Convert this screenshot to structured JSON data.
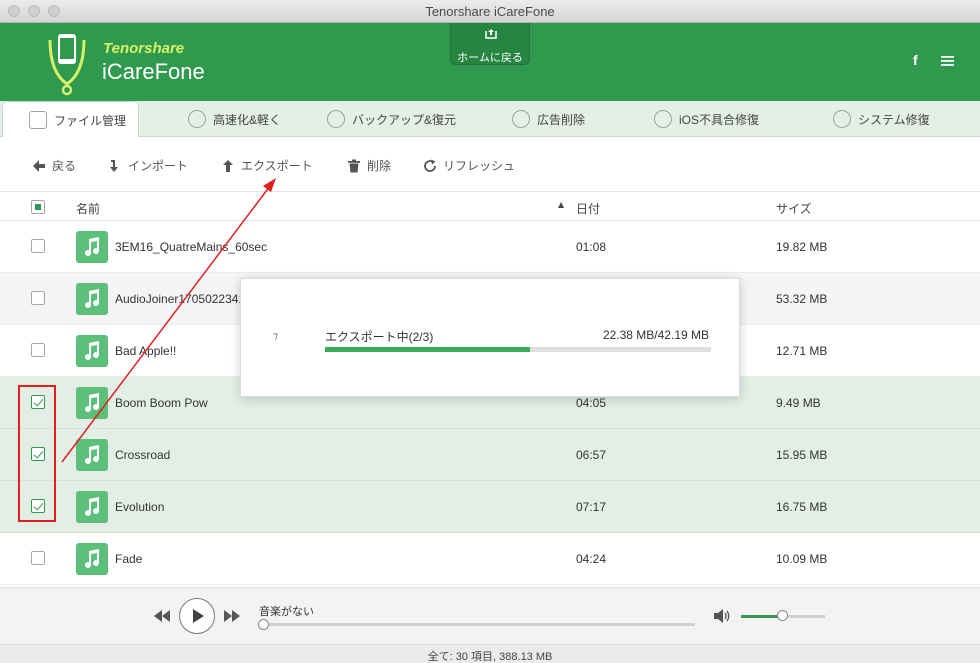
{
  "window": {
    "title": "Tenorshare iCareFone"
  },
  "header": {
    "brand_small": "Tenorshare",
    "brand_big": "iCareFone",
    "home_label": "ホームに戻る",
    "facebook_label": "f"
  },
  "tabs": [
    {
      "label": "ファイル管理",
      "icon": "file-manage-icon",
      "active": true
    },
    {
      "label": "高速化&軽く",
      "icon": "rocket-icon",
      "active": false
    },
    {
      "label": "バックアップ&復元",
      "icon": "folder-icon",
      "active": false
    },
    {
      "label": "広告削除",
      "icon": "trash-icon",
      "active": false
    },
    {
      "label": "iOS不具合修復",
      "icon": "refresh-icon",
      "active": false
    },
    {
      "label": "システム修復",
      "icon": "wrench-icon",
      "active": false
    }
  ],
  "toolbar": {
    "back": "戻る",
    "import": "インポート",
    "export": "エクスポート",
    "delete": "削除",
    "refresh": "リフレッシュ"
  },
  "table": {
    "columns": {
      "name": "名前",
      "date": "日付",
      "size": "サイズ"
    },
    "rows": [
      {
        "name": "3EM16_QuatreMains_60sec",
        "date": "01:08",
        "size": "19.82 MB",
        "checked": false
      },
      {
        "name": "AudioJoiner1705022341",
        "date": "",
        "size": "53.32 MB",
        "checked": false
      },
      {
        "name": "Bad Apple!!",
        "date": "",
        "size": "12.71 MB",
        "checked": false
      },
      {
        "name": "Boom Boom Pow",
        "date": "04:05",
        "size": "9.49 MB",
        "checked": true
      },
      {
        "name": "Crossroad",
        "date": "06:57",
        "size": "15.95 MB",
        "checked": true
      },
      {
        "name": "Evolution",
        "date": "07:17",
        "size": "16.75 MB",
        "checked": true
      },
      {
        "name": "Fade",
        "date": "04:24",
        "size": "10.09 MB",
        "checked": false
      }
    ]
  },
  "export_dialog": {
    "title": "エクスポート中(2/3)",
    "size_text": "22.38 MB/42.19 MB",
    "progress_fraction": 0.53
  },
  "player": {
    "track_label": "音楽がない",
    "volume_fraction": 0.5
  },
  "status": {
    "text": "全て: 30 項目, 388.13 MB"
  },
  "colors": {
    "accent": "#2f9a4d",
    "selected_row": "#e3efe6",
    "highlight": "#e02020"
  }
}
